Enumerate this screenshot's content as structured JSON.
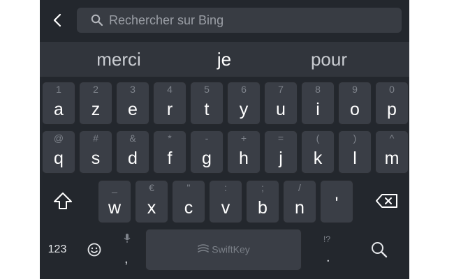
{
  "search": {
    "placeholder": "Rechercher sur Bing"
  },
  "suggestions": [
    "merci",
    "je",
    "pour"
  ],
  "rows": [
    [
      {
        "primary": "a",
        "secondary": "1"
      },
      {
        "primary": "z",
        "secondary": "2"
      },
      {
        "primary": "e",
        "secondary": "3"
      },
      {
        "primary": "r",
        "secondary": "4"
      },
      {
        "primary": "t",
        "secondary": "5"
      },
      {
        "primary": "y",
        "secondary": "6"
      },
      {
        "primary": "u",
        "secondary": "7"
      },
      {
        "primary": "i",
        "secondary": "8"
      },
      {
        "primary": "o",
        "secondary": "9"
      },
      {
        "primary": "p",
        "secondary": "0"
      }
    ],
    [
      {
        "primary": "q",
        "secondary": "@"
      },
      {
        "primary": "s",
        "secondary": "#"
      },
      {
        "primary": "d",
        "secondary": "&"
      },
      {
        "primary": "f",
        "secondary": "*"
      },
      {
        "primary": "g",
        "secondary": "-"
      },
      {
        "primary": "h",
        "secondary": "+"
      },
      {
        "primary": "j",
        "secondary": "="
      },
      {
        "primary": "k",
        "secondary": "("
      },
      {
        "primary": "l",
        "secondary": ")"
      },
      {
        "primary": "m",
        "secondary": "^"
      }
    ],
    [
      {
        "primary": "w",
        "secondary": "_"
      },
      {
        "primary": "x",
        "secondary": "€"
      },
      {
        "primary": "c",
        "secondary": "\""
      },
      {
        "primary": "v",
        "secondary": ":"
      },
      {
        "primary": "b",
        "secondary": ";"
      },
      {
        "primary": "n",
        "secondary": "/"
      },
      {
        "primary": "'",
        "secondary": ""
      }
    ]
  ],
  "bottom": {
    "numbers_label": "123",
    "spacebar_brand": "SwiftKey",
    "left_punct": ",",
    "right_punct": ".",
    "right_punct_secondary": "!?"
  },
  "icons": {
    "back": "chevron-left-icon",
    "search": "search-icon",
    "shift": "shift-icon",
    "backspace": "backspace-icon",
    "emoji": "emoji-icon",
    "mic": "microphone-icon",
    "search_action": "search-icon"
  },
  "colors": {
    "keyboard_bg": "#23272d",
    "key_bg": "#3a3e46",
    "suggestion_bar_bg": "#31353c",
    "key_text": "#ffffff",
    "secondary_text": "#7e838b"
  }
}
